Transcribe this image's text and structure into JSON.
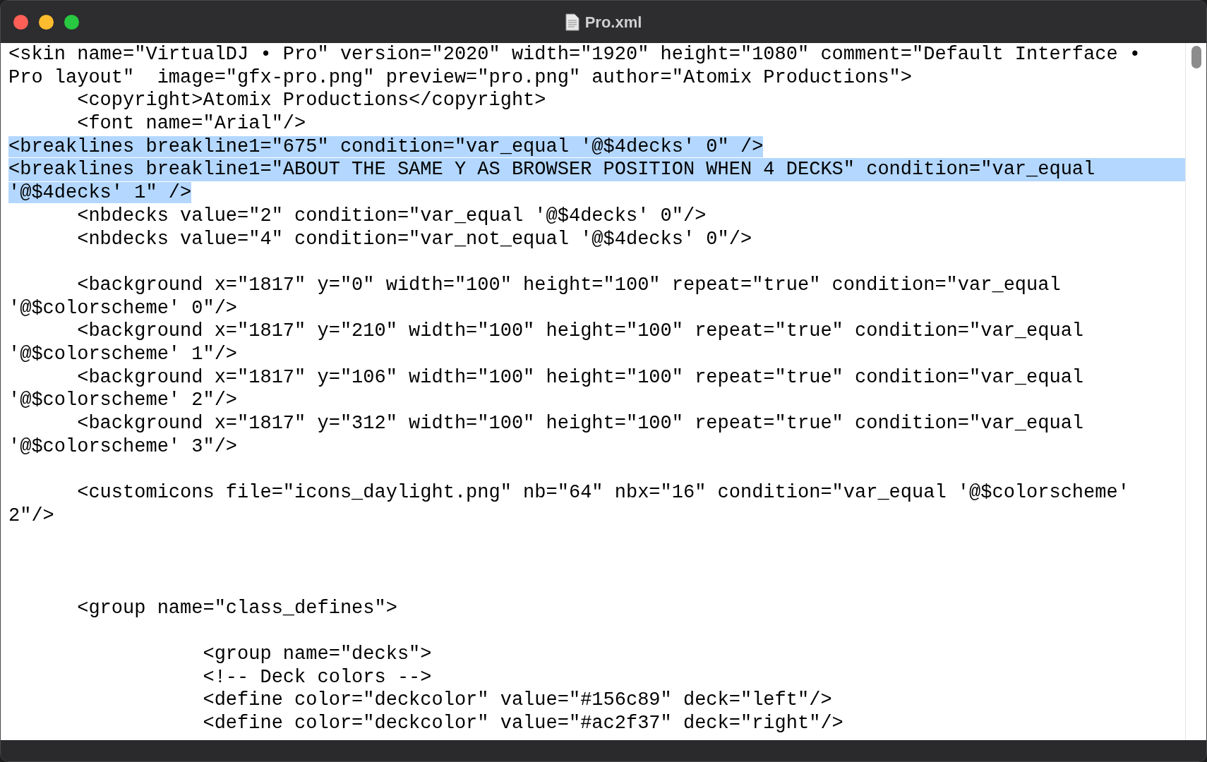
{
  "window": {
    "title": "Pro.xml"
  },
  "lines": [
    {
      "kind": "code",
      "selected": false,
      "rows": [
        "<skin name=\"VirtualDJ • Pro\" version=\"2020\" width=\"1920\" height=\"1080\" comment=\"Default Interface •",
        "Pro layout\"  image=\"gfx-pro.png\" preview=\"pro.png\" author=\"Atomix Productions\">"
      ]
    },
    {
      "kind": "code",
      "selected": false,
      "rows": [
        "      <copyright>Atomix Productions</copyright>"
      ]
    },
    {
      "kind": "code",
      "selected": false,
      "rows": [
        "      <font name=\"Arial\"/>"
      ]
    },
    {
      "kind": "code",
      "selected": true,
      "rows": [
        "<breaklines breakline1=\"675\" condition=\"var_equal '@$4decks' 0\" />"
      ]
    },
    {
      "kind": "code",
      "selected": true,
      "rows": [
        "<breaklines breakline1=\"ABOUT THE SAME Y AS BROWSER POSITION WHEN 4 DECKS\" condition=\"var_equal",
        "'@$4decks' 1\" />"
      ]
    },
    {
      "kind": "code",
      "selected": false,
      "rows": [
        "      <nbdecks value=\"2\" condition=\"var_equal '@$4decks' 0\"/>"
      ]
    },
    {
      "kind": "code",
      "selected": false,
      "rows": [
        "      <nbdecks value=\"4\" condition=\"var_not_equal '@$4decks' 0\"/>"
      ]
    },
    {
      "kind": "blank"
    },
    {
      "kind": "code",
      "selected": false,
      "rows": [
        "      <background x=\"1817\" y=\"0\" width=\"100\" height=\"100\" repeat=\"true\" condition=\"var_equal",
        "'@$colorscheme' 0\"/>"
      ]
    },
    {
      "kind": "code",
      "selected": false,
      "rows": [
        "      <background x=\"1817\" y=\"210\" width=\"100\" height=\"100\" repeat=\"true\" condition=\"var_equal",
        "'@$colorscheme' 1\"/>"
      ]
    },
    {
      "kind": "code",
      "selected": false,
      "rows": [
        "      <background x=\"1817\" y=\"106\" width=\"100\" height=\"100\" repeat=\"true\" condition=\"var_equal",
        "'@$colorscheme' 2\"/>"
      ]
    },
    {
      "kind": "code",
      "selected": false,
      "rows": [
        "      <background x=\"1817\" y=\"312\" width=\"100\" height=\"100\" repeat=\"true\" condition=\"var_equal",
        "'@$colorscheme' 3\"/>"
      ]
    },
    {
      "kind": "blank"
    },
    {
      "kind": "code",
      "selected": false,
      "rows": [
        "      <customicons file=\"icons_daylight.png\" nb=\"64\" nbx=\"16\" condition=\"var_equal '@$colorscheme'",
        "2\"/>"
      ]
    },
    {
      "kind": "blank"
    },
    {
      "kind": "blank"
    },
    {
      "kind": "blank"
    },
    {
      "kind": "code",
      "selected": false,
      "rows": [
        "      <group name=\"class_defines\">"
      ]
    },
    {
      "kind": "blank"
    },
    {
      "kind": "code",
      "selected": false,
      "rows": [
        "                 <group name=\"decks\">"
      ]
    },
    {
      "kind": "code",
      "selected": false,
      "rows": [
        "                 <!-- Deck colors -->"
      ]
    },
    {
      "kind": "code",
      "selected": false,
      "rows": [
        "                 <define color=\"deckcolor\" value=\"#156c89\" deck=\"left\"/>"
      ]
    },
    {
      "kind": "code",
      "selected": false,
      "rows": [
        "                 <define color=\"deckcolor\" value=\"#ac2f37\" deck=\"right\"/>"
      ]
    }
  ]
}
